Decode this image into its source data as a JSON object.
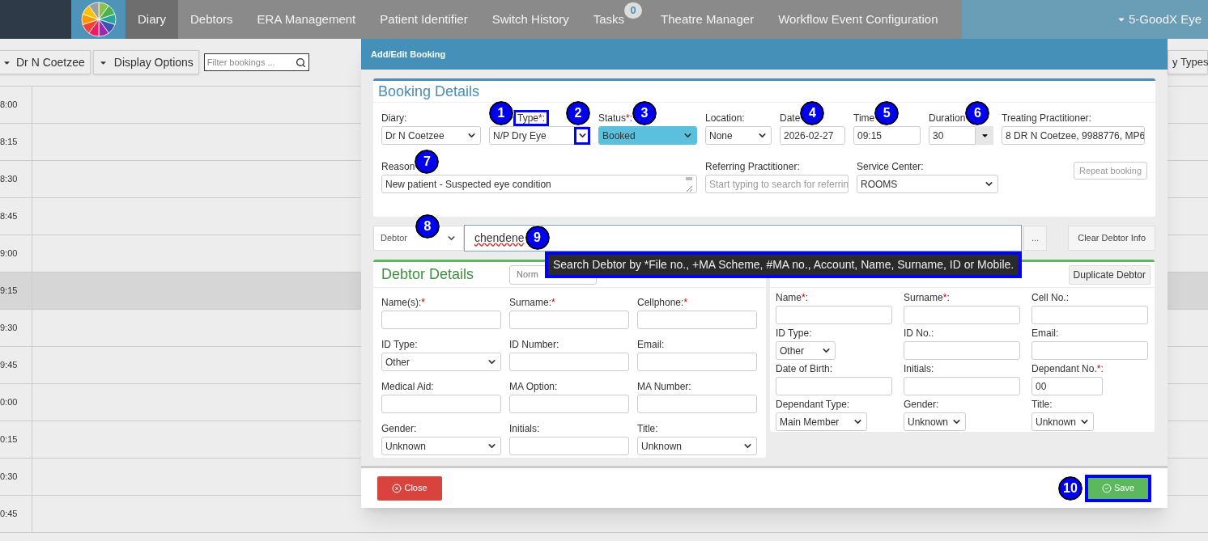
{
  "navbar": {
    "items": [
      {
        "label": "Diary",
        "selected": true
      },
      {
        "label": "Debtors",
        "selected": false
      },
      {
        "label": "ERA Management",
        "selected": false
      },
      {
        "label": "Patient Identifier",
        "selected": false
      },
      {
        "label": "Switch History",
        "selected": false
      },
      {
        "label": "Tasks",
        "selected": false,
        "badge": "0"
      },
      {
        "label": "Theatre Manager",
        "selected": false
      },
      {
        "label": "Workflow Event Configuration",
        "selected": false
      }
    ],
    "account": "5-GoodX Eye"
  },
  "toolbar": {
    "practitioner": "Dr N Coetzee",
    "display_options": "Display Options",
    "filter": {
      "placeholder": "Filter bookings ..."
    },
    "types_button": "y Types"
  },
  "diary": {
    "slots": [
      {
        "time": "8:00",
        "selected": false
      },
      {
        "time": "8:15",
        "selected": false
      },
      {
        "time": "8:30",
        "selected": false
      },
      {
        "time": "8:45",
        "selected": false
      },
      {
        "time": "9:00",
        "selected": false
      },
      {
        "time": "9:15",
        "selected": true
      },
      {
        "time": "9:30",
        "selected": false
      },
      {
        "time": "9:45",
        "selected": false
      },
      {
        "time": "0:00",
        "selected": false
      },
      {
        "time": "0:15",
        "selected": false
      },
      {
        "time": "0:30",
        "selected": false
      },
      {
        "time": "0:45",
        "selected": false
      }
    ]
  },
  "dialog": {
    "title": "Add/Edit Booking",
    "booking": {
      "heading": "Booking Details",
      "row_1": [
        {
          "kind": "select",
          "label": "Diary:",
          "value": "Dr N Coetzee"
        },
        {
          "kind": "select",
          "label": "Type",
          "required": "*",
          "label_end": ":",
          "value": "N/P Dry Eye",
          "highlighted": true,
          "marker_before": "1",
          "marker_end": "2"
        },
        {
          "kind": "select",
          "label": "Status",
          "required": "*",
          "label_end": ":",
          "value": "Booked",
          "color": "#5bc0de",
          "marker": "3"
        },
        {
          "kind": "select",
          "label": "Location:",
          "value": "None"
        },
        {
          "kind": "input",
          "label": "Date",
          "value": "2026-02-27",
          "marker": "4"
        },
        {
          "kind": "input",
          "label": "Time",
          "value": "09:15",
          "marker": "5"
        },
        {
          "kind": "combo",
          "label": "Duration",
          "value": "30",
          "marker": "6"
        },
        {
          "kind": "input",
          "label": "Treating Practitioner:",
          "value": "8 DR N Coetzee, 9988776, MP6"
        }
      ],
      "row_2": [
        {
          "kind": "textarea",
          "label": "Reason",
          "value": "New patient - Suspected eye condition",
          "marker": "7"
        },
        {
          "kind": "input",
          "label": "Referring Practitioner:",
          "placeholder": "Start typing to search for referrin"
        },
        {
          "kind": "select",
          "label": "Service Center:",
          "value": "ROOMS"
        }
      ],
      "repeat_button": "Repeat booking"
    },
    "search": {
      "type": {
        "value": "Debtor",
        "marker": "8"
      },
      "input": {
        "value": "chendene",
        "marker": "9"
      },
      "more_button": "...",
      "clear_button": "Clear Debtor Info"
    },
    "tooltip": {
      "text": "Search Debtor by *File no., +MA Scheme, #MA no., Account, Name, Surname, ID or Mobile.",
      "highlighted": true
    },
    "debtor": {
      "heading": "Debtor Details",
      "mode": "Norm",
      "fields": [
        {
          "kind": "input",
          "label": "Name(s):",
          "required": "*"
        },
        {
          "kind": "input",
          "label": "Surname:",
          "required": "*"
        },
        {
          "kind": "input",
          "label": "Cellphone:",
          "required": "*"
        },
        {
          "kind": "select",
          "label": "ID Type:",
          "value": "Other"
        },
        {
          "kind": "input",
          "label": "ID Number:"
        },
        {
          "kind": "input",
          "label": "Email:"
        },
        {
          "kind": "input",
          "label": "Medical Aid:"
        },
        {
          "kind": "input",
          "label": "MA Option:"
        },
        {
          "kind": "input",
          "label": "MA Number:"
        },
        {
          "kind": "select",
          "label": "Gender:",
          "value": "Unknown"
        },
        {
          "kind": "input",
          "label": "Initials:"
        },
        {
          "kind": "select",
          "label": "Title:",
          "value": "Unknown"
        }
      ]
    },
    "patient": {
      "duplicate_button": "Duplicate Debtor",
      "fields": [
        {
          "kind": "input",
          "label": "Name",
          "required": "*",
          "label_end": ":"
        },
        {
          "kind": "input",
          "label": "Surname",
          "required": "*",
          "label_end": ":"
        },
        {
          "kind": "input",
          "label": "Cell No.:"
        },
        {
          "kind": "select",
          "label": "ID Type:",
          "value": "Other"
        },
        {
          "kind": "input",
          "label": "ID No.:"
        },
        {
          "kind": "input",
          "label": "Email:"
        },
        {
          "kind": "input",
          "label": "Date of Birth:"
        },
        {
          "kind": "input",
          "label": "Initials:"
        },
        {
          "kind": "input",
          "label": "Dependant No.",
          "required": "*",
          "label_end": ":",
          "value": "00"
        },
        {
          "kind": "select",
          "label": "Dependant Type:",
          "value": "Main Member"
        },
        {
          "kind": "select",
          "label": "Gender:",
          "value": "Unknown"
        },
        {
          "kind": "select",
          "label": "Title:",
          "value": "Unknown"
        }
      ]
    },
    "footer": {
      "close_button": "Close",
      "save_button": {
        "label": "Save",
        "highlighted": true,
        "marker": "10"
      }
    }
  }
}
